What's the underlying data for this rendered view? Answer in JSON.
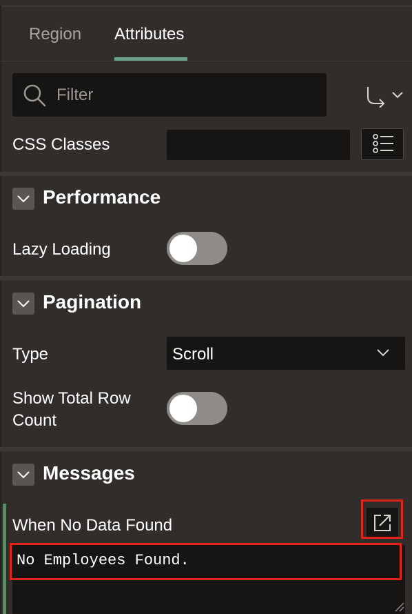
{
  "tabs": [
    {
      "label": "Region",
      "active": false
    },
    {
      "label": "Attributes",
      "active": true
    }
  ],
  "filter": {
    "placeholder": "Filter"
  },
  "appearance": {
    "css_classes_label": "CSS Classes",
    "css_classes_value": ""
  },
  "performance": {
    "title": "Performance",
    "lazy_loading_label": "Lazy Loading",
    "lazy_loading_on": false
  },
  "pagination": {
    "title": "Pagination",
    "type_label": "Type",
    "type_value": "Scroll",
    "show_total_label_line1": "Show Total Row",
    "show_total_label_line2": "Count",
    "show_total_on": false
  },
  "messages": {
    "title": "Messages",
    "no_data_label": "When No Data Found",
    "no_data_value": "No Employees Found."
  },
  "colors": {
    "accent": "#68a089",
    "highlight": "#e0241b",
    "panel_bg": "#312d2a",
    "field_bg": "#161513"
  },
  "icons": [
    "search-icon",
    "goto-group-icon",
    "chevron-down-icon",
    "list-icon",
    "expand-icon",
    "resize-grip-icon"
  ]
}
